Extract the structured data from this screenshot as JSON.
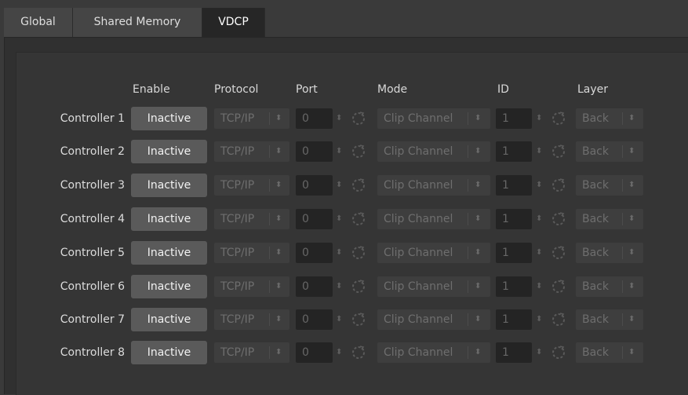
{
  "tabs": [
    {
      "label": "Global",
      "active": false
    },
    {
      "label": "Shared Memory",
      "active": false
    },
    {
      "label": "VDCP",
      "active": true
    }
  ],
  "headers": {
    "enable": "Enable",
    "protocol": "Protocol",
    "port": "Port",
    "mode": "Mode",
    "id": "ID",
    "layer": "Layer"
  },
  "controllers": [
    {
      "label": "Controller 1",
      "enable": "Inactive",
      "protocol": "TCP/IP",
      "port": "0",
      "mode": "Clip Channel",
      "id": "1",
      "layer": "Back"
    },
    {
      "label": "Controller 2",
      "enable": "Inactive",
      "protocol": "TCP/IP",
      "port": "0",
      "mode": "Clip Channel",
      "id": "1",
      "layer": "Back"
    },
    {
      "label": "Controller 3",
      "enable": "Inactive",
      "protocol": "TCP/IP",
      "port": "0",
      "mode": "Clip Channel",
      "id": "1",
      "layer": "Back"
    },
    {
      "label": "Controller 4",
      "enable": "Inactive",
      "protocol": "TCP/IP",
      "port": "0",
      "mode": "Clip Channel",
      "id": "1",
      "layer": "Back"
    },
    {
      "label": "Controller 5",
      "enable": "Inactive",
      "protocol": "TCP/IP",
      "port": "0",
      "mode": "Clip Channel",
      "id": "1",
      "layer": "Back"
    },
    {
      "label": "Controller 6",
      "enable": "Inactive",
      "protocol": "TCP/IP",
      "port": "0",
      "mode": "Clip Channel",
      "id": "1",
      "layer": "Back"
    },
    {
      "label": "Controller 7",
      "enable": "Inactive",
      "protocol": "TCP/IP",
      "port": "0",
      "mode": "Clip Channel",
      "id": "1",
      "layer": "Back"
    },
    {
      "label": "Controller 8",
      "enable": "Inactive",
      "protocol": "TCP/IP",
      "port": "0",
      "mode": "Clip Channel",
      "id": "1",
      "layer": "Back"
    }
  ],
  "icons": {
    "spinner_arrows": "up-down-arrows-icon",
    "reset": "reset-circle-icon",
    "combo_arrow": "combo-arrow-icon"
  },
  "colors": {
    "background": "#3a3a3a",
    "active_tab": "#262626",
    "button": "#5a5a5a",
    "disabled_text": "#6e6e6e"
  }
}
